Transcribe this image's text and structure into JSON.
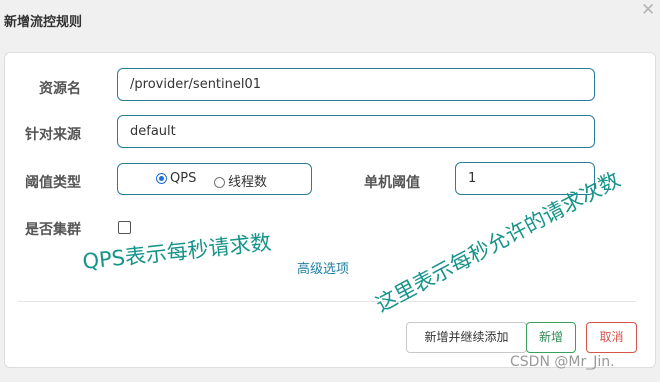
{
  "dialog": {
    "title": "新增流控规则",
    "close_icon": "close-icon"
  },
  "form": {
    "resource": {
      "label": "资源名",
      "value": "/provider/sentinel01"
    },
    "limit_app": {
      "label": "针对来源",
      "value": "default"
    },
    "grade": {
      "label": "阈值类型",
      "options": [
        {
          "label": "QPS",
          "selected": true
        },
        {
          "label": "线程数",
          "selected": false
        }
      ]
    },
    "count": {
      "label": "单机阈值",
      "value": "1"
    },
    "cluster": {
      "label": "是否集群",
      "checked": false
    },
    "advanced_link": "高级选项"
  },
  "buttons": {
    "add_continue": "新增并继续添加",
    "add": "新增",
    "cancel": "取消"
  },
  "annotations": {
    "qps_note": "QPS表示每秒请求数",
    "threshold_note": "这里表示每秒允许的请求次数"
  },
  "watermark": "CSDN @Mr_Jin.",
  "colors": {
    "accent": "#2a7f94",
    "success": "#3aa05b",
    "danger": "#d9534f",
    "annotation": "#17948a"
  }
}
